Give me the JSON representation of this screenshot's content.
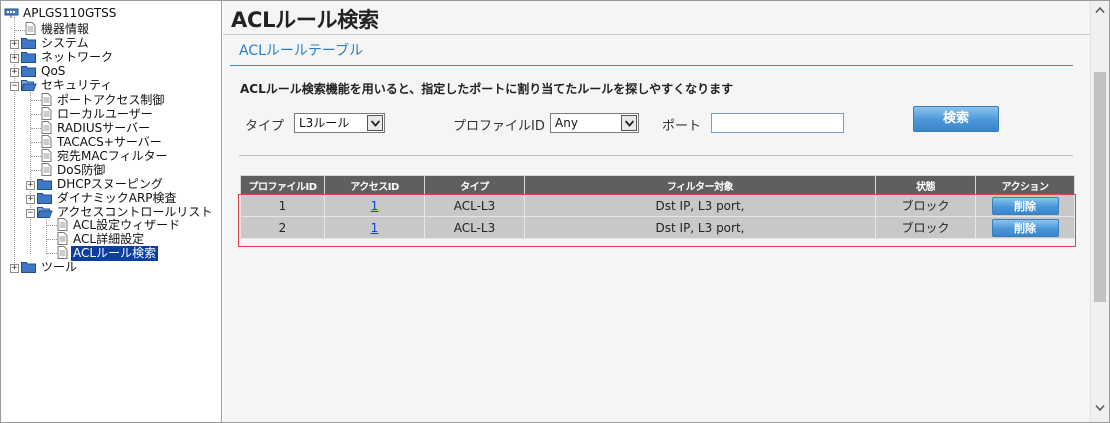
{
  "tree": {
    "root": "APLGS110GTSS",
    "items": [
      {
        "label": "機器情報",
        "type": "page"
      },
      {
        "label": "システム",
        "type": "folder"
      },
      {
        "label": "ネットワーク",
        "type": "folder"
      },
      {
        "label": "QoS",
        "type": "folder"
      },
      {
        "label": "セキュリティ",
        "type": "folder-open"
      },
      {
        "label": "ポートアクセス制御",
        "type": "page"
      },
      {
        "label": "ローカルユーザー",
        "type": "page"
      },
      {
        "label": "RADIUSサーバー",
        "type": "page"
      },
      {
        "label": "TACACS+サーバー",
        "type": "page"
      },
      {
        "label": "宛先MACフィルター",
        "type": "page"
      },
      {
        "label": "DoS防御",
        "type": "page"
      },
      {
        "label": "DHCPスヌーピング",
        "type": "folder"
      },
      {
        "label": "ダイナミックARP検査",
        "type": "folder"
      },
      {
        "label": "アクセスコントロールリスト",
        "type": "folder-open"
      },
      {
        "label": "ACL設定ウィザード",
        "type": "page"
      },
      {
        "label": "ACL詳細設定",
        "type": "page"
      },
      {
        "label": "ACLルール検索",
        "type": "page"
      },
      {
        "label": "ツール",
        "type": "folder"
      }
    ]
  },
  "page": {
    "title": "ACLルール検索",
    "section_title": "ACLルールテーブル",
    "description": "ACLルール検索機能を用いると、指定したポートに割り当てたルールを探しやすくなります"
  },
  "form": {
    "type_label": "タイプ",
    "type_value": "L3ルール",
    "profile_label": "プロファイルID",
    "profile_value": "Any",
    "port_label": "ポート",
    "port_value": "",
    "search_button": "検索"
  },
  "table": {
    "headers": [
      "プロファイルID",
      "アクセスID",
      "タイプ",
      "フィルター対象",
      "状態",
      "アクション"
    ],
    "rows": [
      {
        "profile_id": "1",
        "access_id": "1",
        "type": "ACL-L3",
        "filter": "Dst IP, L3 port,",
        "state": "ブロック",
        "action": "削除"
      },
      {
        "profile_id": "2",
        "access_id": "1",
        "type": "ACL-L3",
        "filter": "Dst IP, L3 port,",
        "state": "ブロック",
        "action": "削除"
      }
    ]
  },
  "colors": {
    "accent": "#2b7fc3",
    "table_header": "#5f5f5f",
    "table_cell": "#c8c8c8",
    "selection": "#0a3fa0",
    "highlight_border": "#d9434b"
  }
}
